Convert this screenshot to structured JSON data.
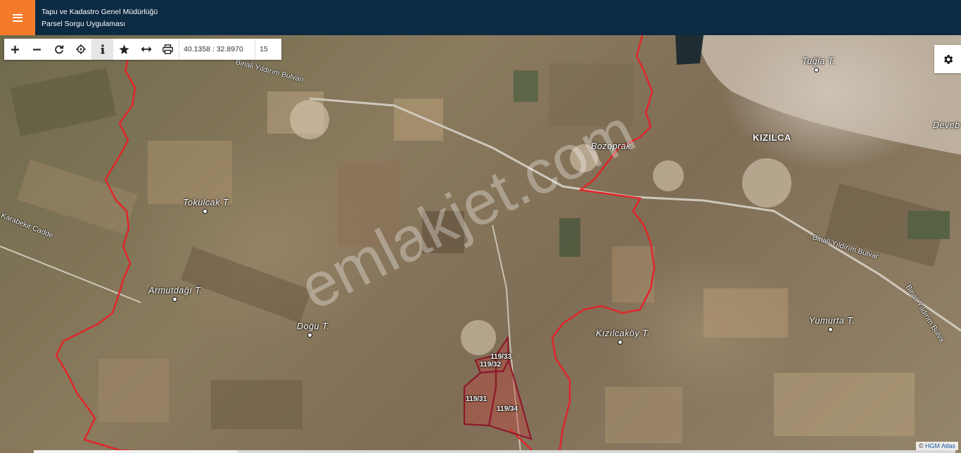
{
  "header": {
    "title_line1": "Tapu ve Kadastro Genel Müdürlüğü",
    "title_line2": "Parsel Sorgu Uygulaması",
    "menu_icon": "hamburger-icon",
    "colors": {
      "bar": "#0d2a43",
      "menu": "#f57a2a"
    }
  },
  "toolbar": {
    "buttons": [
      {
        "name": "zoom-in",
        "icon": "plus-icon"
      },
      {
        "name": "zoom-out",
        "icon": "minus-icon"
      },
      {
        "name": "refresh",
        "icon": "refresh-icon"
      },
      {
        "name": "locate",
        "icon": "crosshair-icon"
      },
      {
        "name": "info",
        "icon": "info-icon",
        "active": true
      },
      {
        "name": "favorite",
        "icon": "star-icon"
      },
      {
        "name": "measure",
        "icon": "measure-arrows-icon"
      },
      {
        "name": "print",
        "icon": "printer-icon"
      }
    ],
    "coordinate_value": "40.1358 : 32.8970",
    "zoom_value": "15"
  },
  "settings": {
    "icon": "gear-icon"
  },
  "map": {
    "places": [
      {
        "key": "tugla",
        "label": "Tuğla T."
      },
      {
        "key": "kizilca",
        "label": "KIZILCA"
      },
      {
        "key": "devebo",
        "label": "Deveb"
      },
      {
        "key": "bozoprak",
        "label": "Bozoprak"
      },
      {
        "key": "tokulcak",
        "label": "Tokulcak T."
      },
      {
        "key": "armutdagi",
        "label": "Armutdağı T."
      },
      {
        "key": "dogu",
        "label": "Doğu T."
      },
      {
        "key": "kizilcakoy",
        "label": "Kızılcaköy T."
      },
      {
        "key": "yumurta",
        "label": "Yumurta T."
      }
    ],
    "roads": [
      {
        "key": "bulvar_top",
        "label": "Binali Yıldırım Bulvarı"
      },
      {
        "key": "karabekir",
        "label": "Karabekir Cadde"
      },
      {
        "key": "bulvar_mid",
        "label": "Binali Yıldırım Bulvar"
      },
      {
        "key": "bulvar_right",
        "label": "Binali Yıldırım Bulva"
      }
    ],
    "parcels": [
      {
        "key": "p33",
        "label": "119/33"
      },
      {
        "key": "p32",
        "label": "119/32"
      },
      {
        "key": "p31",
        "label": "119/31"
      },
      {
        "key": "p34",
        "label": "119/34"
      }
    ],
    "boundary_color": "#e0262a",
    "parcel_color": "#8b1a2b"
  },
  "watermark": "emlakjet.com",
  "attribution": {
    "prefix": "©",
    "brand": "HGM Atlas"
  }
}
